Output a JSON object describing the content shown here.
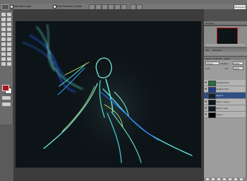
{
  "options_bar": {
    "auto_select_label": "Auto-Select Layer",
    "show_transform_label": "Show Transform Controls",
    "workspace_label": "Workspace ▾"
  },
  "panels": {
    "navigator_tab": "Navigator",
    "histogram_tab": "Info",
    "histogram_tab2": "Histogram",
    "layers_tabs": [
      "Layers",
      "Channels",
      "Paths"
    ],
    "blend_mode": "Screen",
    "opacity_label": "Opacity:",
    "opacity_value": "100%",
    "lock_label": "Lock:",
    "fill_label": "Fill:",
    "fill_value": "100%"
  },
  "layers": [
    {
      "name": "Gradient Fill 2",
      "visible": true,
      "selected": false,
      "thumb": "#2a6d3a"
    },
    {
      "name": "Gradient Fill 1",
      "visible": true,
      "selected": false,
      "thumb": "#1f3f8a"
    },
    {
      "name": "Layer 3",
      "visible": true,
      "selected": true,
      "thumb": "#122030"
    },
    {
      "name": "Layer 1 copy 2",
      "visible": true,
      "selected": false,
      "thumb": "#0e1820"
    },
    {
      "name": "Layer 1 copy",
      "visible": true,
      "selected": false,
      "thumb": "#101a22"
    },
    {
      "name": "Layer 1",
      "visible": true,
      "selected": false,
      "thumb": "#000000"
    }
  ],
  "colors": {
    "foreground": "#b0121a",
    "background": "#f2f2f2",
    "glow_cyan": "#5ff0e0",
    "glow_blue": "#2a5cff",
    "glow_yellow": "#d8f070"
  }
}
